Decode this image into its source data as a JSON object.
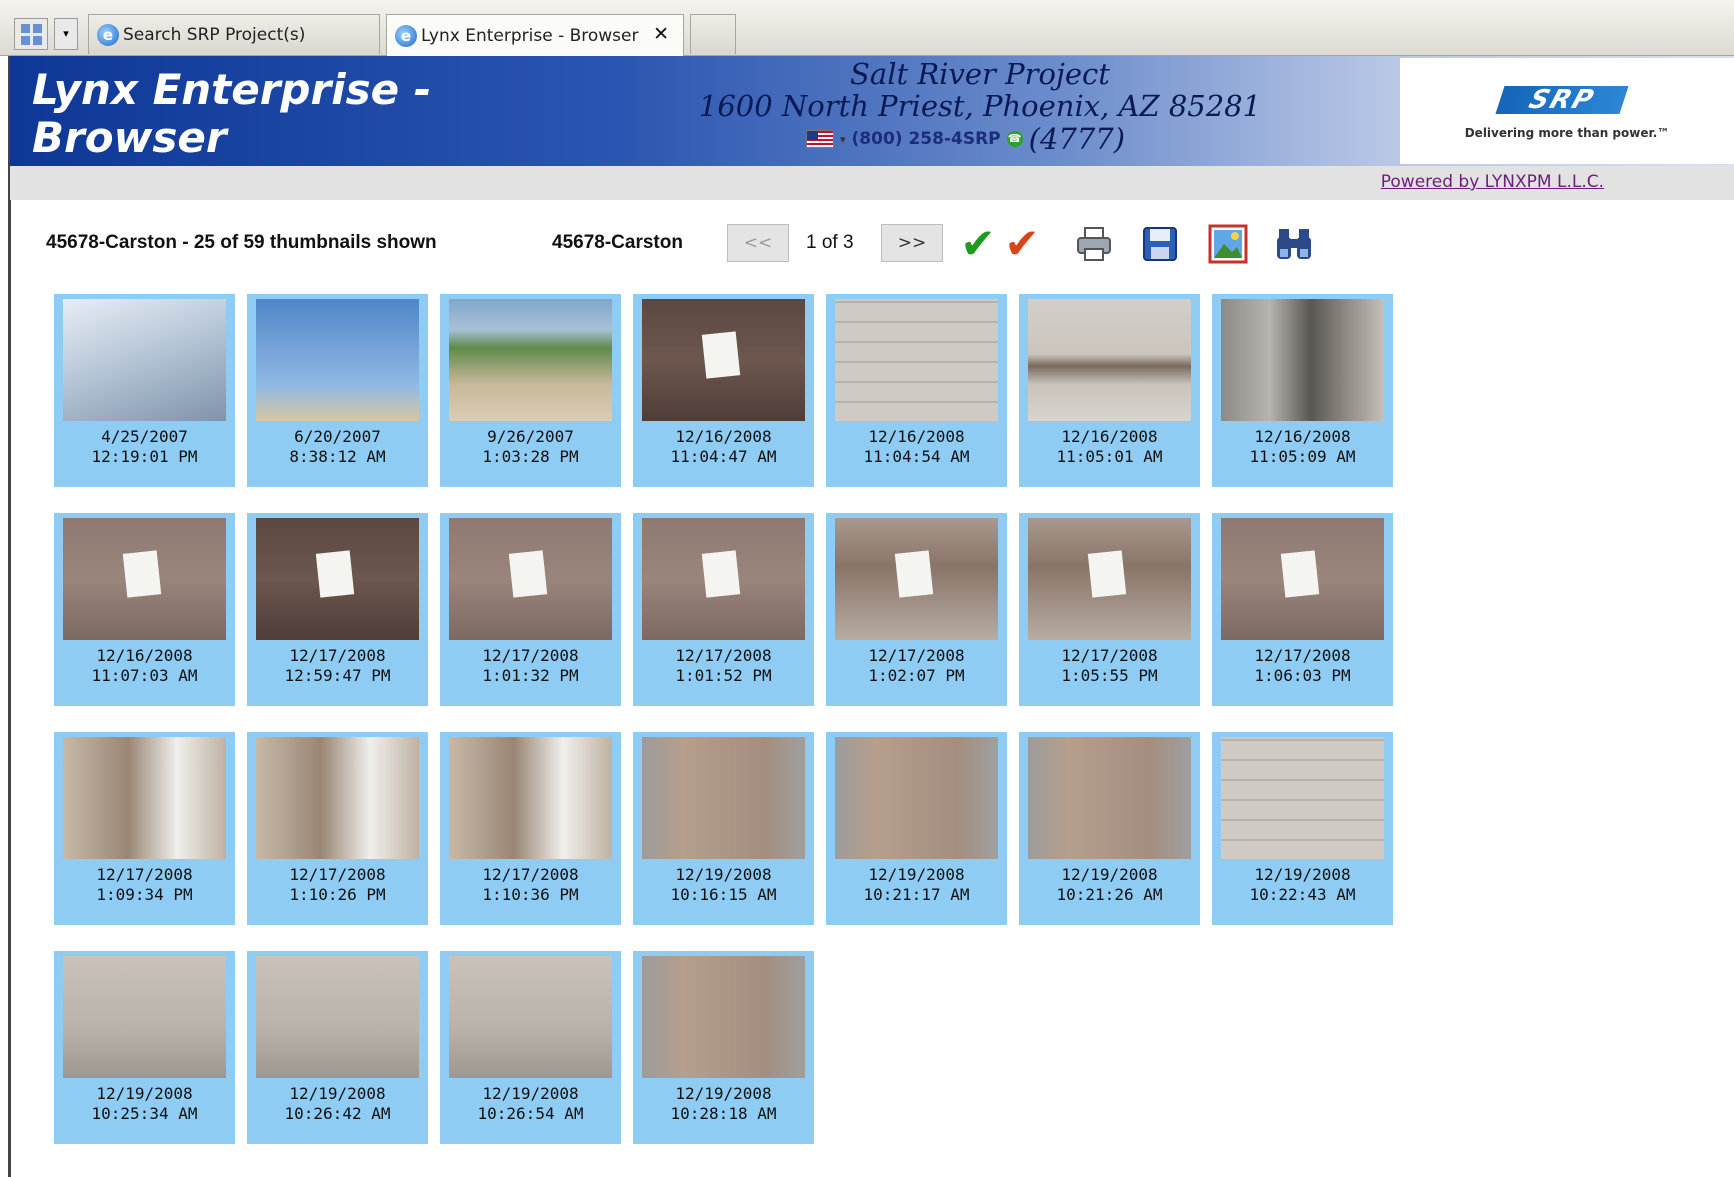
{
  "browser": {
    "tabs": [
      {
        "label": "Search SRP Project(s)",
        "active": false
      },
      {
        "label": "Lynx Enterprise - Browser",
        "active": true
      }
    ],
    "close_glyph": "✕"
  },
  "header": {
    "app_title_line1": "Lynx Enterprise -",
    "app_title_line2": "Browser",
    "company_name": "Salt River Project",
    "company_address": "1600 North Priest, Phoenix, AZ 85281",
    "phone": "(800) 258-4SRP",
    "extension": "(4777)",
    "logo_text": "SRP",
    "logo_tagline": "Delivering more than power.™",
    "powered_by": "Powered by LYNXPM L.L.C."
  },
  "toolbar": {
    "summary": "45678-Carston - 25 of 59 thumbnails shown",
    "project": "45678-Carston",
    "prev_label": "<<",
    "next_label": ">>",
    "page_label": "1 of 3",
    "icons": [
      "check-green-icon",
      "check-red-icon",
      "printer-icon",
      "save-icon",
      "image-icon",
      "binoculars-icon"
    ]
  },
  "colors": {
    "header_start": "#0e3796",
    "thumb_bg": "#8fccf4",
    "link": "#6b1f7a"
  },
  "thumbnails": [
    {
      "date": "4/25/2007",
      "time": "12:19:01 PM",
      "scene": "pole-sky"
    },
    {
      "date": "6/20/2007",
      "time": "8:38:12 AM",
      "scene": "pole-workers"
    },
    {
      "date": "9/26/2007",
      "time": "1:03:28 PM",
      "scene": "construction-site"
    },
    {
      "date": "12/16/2008",
      "time": "11:04:47 AM",
      "scene": "wall-note-dark"
    },
    {
      "date": "12/16/2008",
      "time": "11:04:54 AM",
      "scene": "block-wall"
    },
    {
      "date": "12/16/2008",
      "time": "11:05:01 AM",
      "scene": "block-wall-stain"
    },
    {
      "date": "12/16/2008",
      "time": "11:05:09 AM",
      "scene": "room-corner"
    },
    {
      "date": "12/16/2008",
      "time": "11:07:03 AM",
      "scene": "wall-note-hand"
    },
    {
      "date": "12/17/2008",
      "time": "12:59:47 PM",
      "scene": "wall-note-dark"
    },
    {
      "date": "12/17/2008",
      "time": "1:01:32 PM",
      "scene": "wall-note-hand"
    },
    {
      "date": "12/17/2008",
      "time": "1:01:52 PM",
      "scene": "wall-note-hand"
    },
    {
      "date": "12/17/2008",
      "time": "1:02:07 PM",
      "scene": "wall-note-stain"
    },
    {
      "date": "12/17/2008",
      "time": "1:05:55 PM",
      "scene": "wall-note-stain"
    },
    {
      "date": "12/17/2008",
      "time": "1:06:03 PM",
      "scene": "wall-note-hand"
    },
    {
      "date": "12/17/2008",
      "time": "1:09:34 PM",
      "scene": "wall-exit"
    },
    {
      "date": "12/17/2008",
      "time": "1:10:26 PM",
      "scene": "wall-exit"
    },
    {
      "date": "12/17/2008",
      "time": "1:10:36 PM",
      "scene": "wall-exit"
    },
    {
      "date": "12/19/2008",
      "time": "10:16:15 AM",
      "scene": "room-studs"
    },
    {
      "date": "12/19/2008",
      "time": "10:21:17 AM",
      "scene": "room-studs"
    },
    {
      "date": "12/19/2008",
      "time": "10:21:26 AM",
      "scene": "room-studs"
    },
    {
      "date": "12/19/2008",
      "time": "10:22:43 AM",
      "scene": "block-wall"
    },
    {
      "date": "12/19/2008",
      "time": "10:25:34 AM",
      "scene": "room-empty"
    },
    {
      "date": "12/19/2008",
      "time": "10:26:42 AM",
      "scene": "room-empty"
    },
    {
      "date": "12/19/2008",
      "time": "10:26:54 AM",
      "scene": "room-empty"
    },
    {
      "date": "12/19/2008",
      "time": "10:28:18 AM",
      "scene": "room-studs"
    }
  ]
}
